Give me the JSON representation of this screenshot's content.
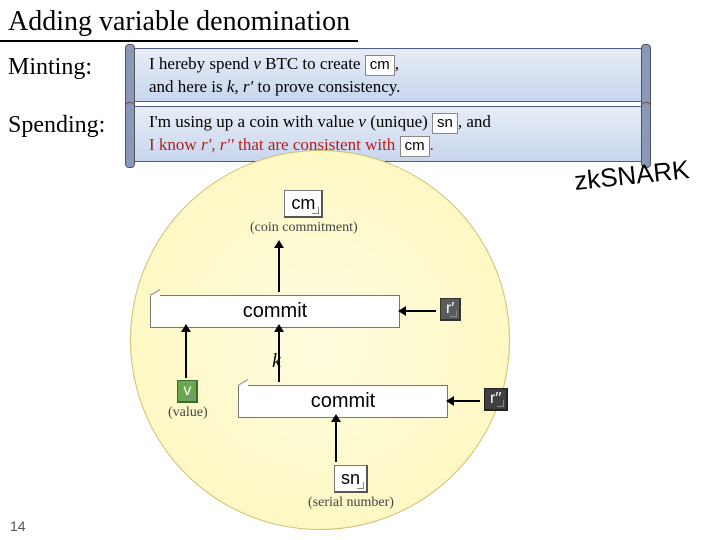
{
  "title": "Adding variable denomination",
  "zksnark_label": "zkSNARK",
  "page_number": "14",
  "minting": {
    "label": "Minting:",
    "line1_pre": "I hereby spend ",
    "line1_var": "v",
    "line1_mid": " BTC to create ",
    "line1_tag": "cm",
    "line1_post": ",",
    "line2_pre": "and here is ",
    "line2_vars": "k, r′",
    "line2_post": " to prove consistency."
  },
  "spending": {
    "label": "Spending:",
    "line1_pre": "I'm using up a coin with value ",
    "line1_var": "v",
    "line1_mid": " (unique) ",
    "line1_tag": "sn",
    "line1_post": ", and",
    "line2_pre": "I know ",
    "line2_vars": "r′, r′′",
    "line2_mid": " that are consistent with ",
    "line2_tag": "cm",
    "line2_post": "."
  },
  "diagram": {
    "cm": {
      "tag": "cm",
      "caption": "(coin commitment)"
    },
    "commit_label": "commit",
    "k_symbol": "k",
    "v": {
      "tag": "v",
      "caption": "(value)"
    },
    "sn": {
      "tag": "sn",
      "caption": "(serial number)"
    },
    "r1": {
      "tag": "r′"
    },
    "r2": {
      "tag": "r′′"
    }
  }
}
